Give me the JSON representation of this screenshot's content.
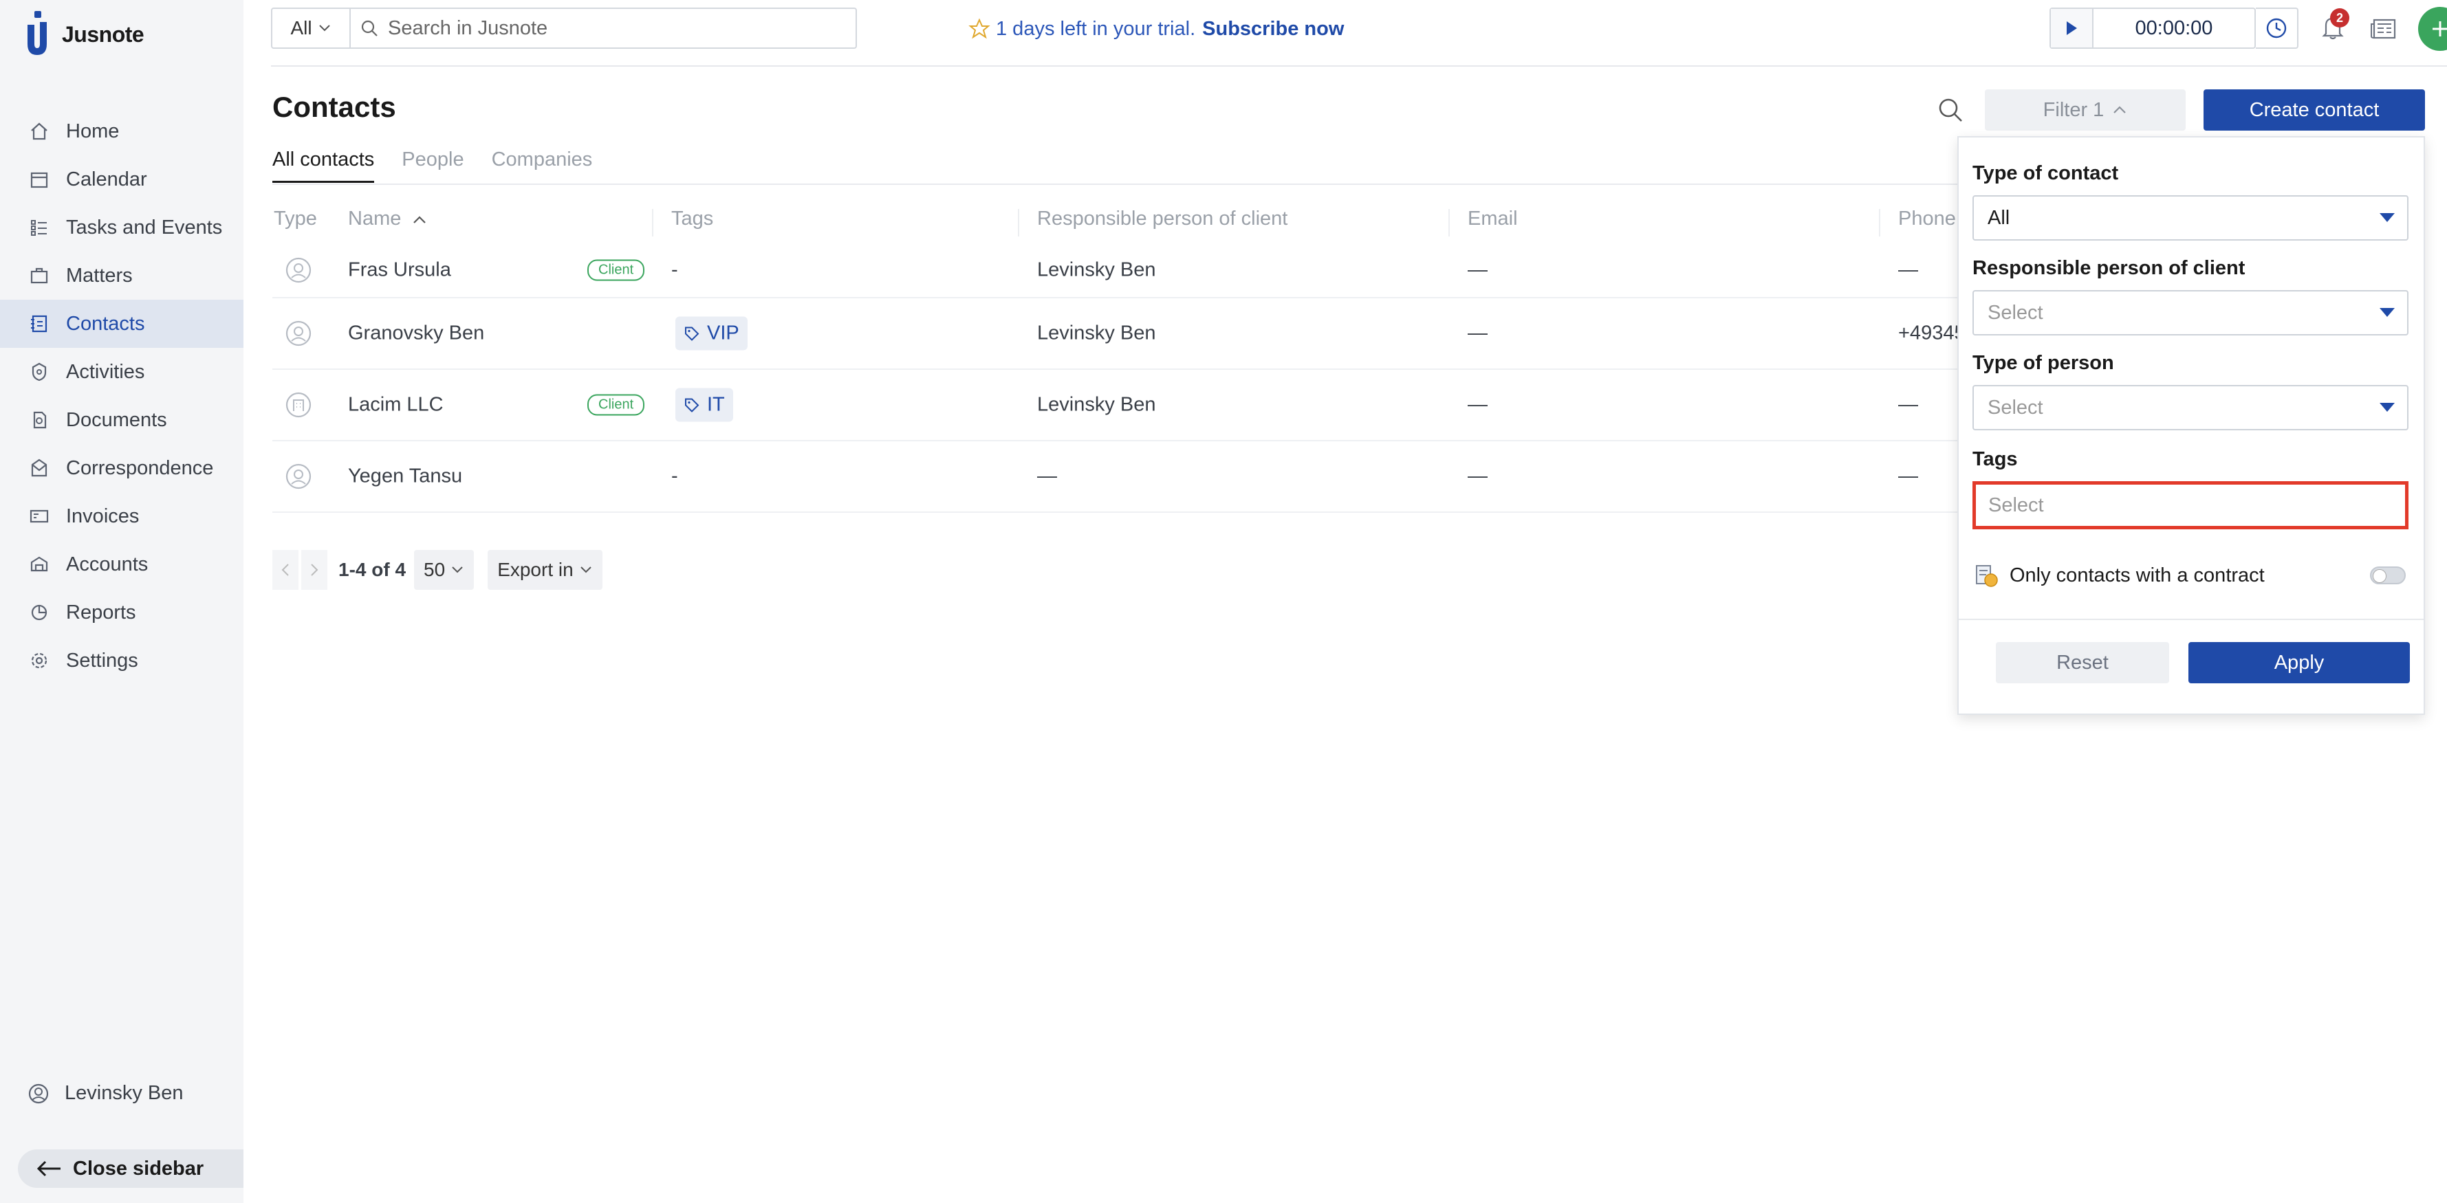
{
  "app": {
    "name": "Jusnote"
  },
  "sidebar": {
    "items": [
      {
        "label": "Home",
        "icon": "home-icon"
      },
      {
        "label": "Calendar",
        "icon": "calendar-icon"
      },
      {
        "label": "Tasks and Events",
        "icon": "tasks-icon"
      },
      {
        "label": "Matters",
        "icon": "briefcase-icon"
      },
      {
        "label": "Contacts",
        "icon": "contacts-icon",
        "active": true
      },
      {
        "label": "Activities",
        "icon": "activities-icon"
      },
      {
        "label": "Documents",
        "icon": "documents-icon"
      },
      {
        "label": "Correspondence",
        "icon": "correspondence-icon"
      },
      {
        "label": "Invoices",
        "icon": "invoices-icon"
      },
      {
        "label": "Accounts",
        "icon": "accounts-icon"
      },
      {
        "label": "Reports",
        "icon": "reports-icon"
      },
      {
        "label": "Settings",
        "icon": "settings-icon"
      }
    ],
    "user": "Levinsky Ben",
    "close_label": "Close sidebar"
  },
  "topbar": {
    "scope": "All",
    "search_placeholder": "Search in Jusnote",
    "trial_text": "1 days left in your trial.",
    "subscribe": "Subscribe now",
    "timer": "00:00:00",
    "notifications": "2"
  },
  "page": {
    "title": "Contacts",
    "tabs": [
      "All contacts",
      "People",
      "Companies"
    ],
    "filter_label": "Filter 1",
    "create_label": "Create contact"
  },
  "table": {
    "headers": {
      "type": "Type",
      "name": "Name",
      "tags": "Tags",
      "responsible": "Responsible person of client",
      "email": "Email",
      "phone": "Phone"
    },
    "rows": [
      {
        "name": "Fras Ursula",
        "badge": "Client",
        "tag": "-",
        "responsible": "Levinsky Ben",
        "email": "—",
        "phone": "—"
      },
      {
        "name": "Granovsky Ben",
        "badge": "",
        "tag": "VIP",
        "responsible": "Levinsky Ben",
        "email": "—",
        "phone": "+49345"
      },
      {
        "name": "Lacim LLC",
        "badge": "Client",
        "tag": "IT",
        "responsible": "Levinsky Ben",
        "email": "—",
        "phone": "—"
      },
      {
        "name": "Yegen Tansu",
        "badge": "",
        "tag": "-",
        "responsible": "—",
        "email": "—",
        "phone": "—"
      }
    ],
    "pagination": {
      "range": "1-4 of 4",
      "per_page": "50",
      "export": "Export in"
    }
  },
  "filter": {
    "type_label": "Type of contact",
    "type_value": "All",
    "responsible_label": "Responsible person of client",
    "responsible_placeholder": "Select",
    "person_label": "Type of person",
    "person_placeholder": "Select",
    "tags_label": "Tags",
    "tags_placeholder": "Select",
    "contract_label": "Only contacts with a contract",
    "reset": "Reset",
    "apply": "Apply"
  },
  "colors": {
    "brand": "#1f4aa8",
    "client_badge": "#3aa55d",
    "highlight": "#e23a2a",
    "alert": "#c62f2f"
  }
}
